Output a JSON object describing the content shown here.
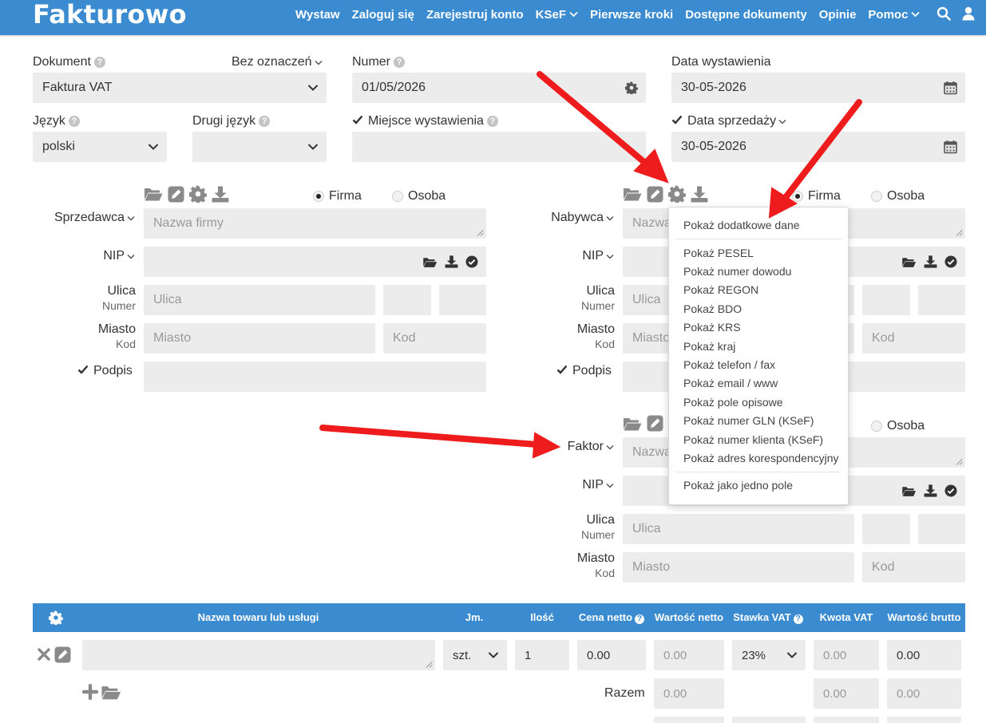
{
  "nav": {
    "logo": "Fakturowo",
    "items": [
      "Wystaw",
      "Zaloguj się",
      "Zarejestruj konto",
      "KSeF",
      "Pierwsze kroki",
      "Dostępne dokumenty",
      "Opinie",
      "Pomoc"
    ]
  },
  "form": {
    "dokument_label": "Dokument",
    "bez_oznaczen": "Bez oznaczeń",
    "dokument_value": "Faktura VAT",
    "numer_label": "Numer",
    "numer_value": "01/05/2026",
    "data_wystawienia_label": "Data wystawienia",
    "data_wystawienia_value": "30-05-2026",
    "jezyk_label": "Język",
    "jezyk_value": "polski",
    "drugi_jezyk_label": "Drugi język",
    "drugi_jezyk_value": "",
    "miejsce_label": "Miejsce wystawienia",
    "data_sprzedazy_label": "Data sprzedaży",
    "data_sprzedazy_value": "30-05-2026"
  },
  "seller": {
    "title": "Sprzedawca",
    "firma": "Firma",
    "osoba": "Osoba",
    "name_placeholder": "Nazwa firmy",
    "nip_label": "NIP",
    "ulica_label": "Ulica",
    "numer_label": "Numer",
    "ulica_placeholder": "Ulica",
    "miasto_label": "Miasto",
    "kod_label": "Kod",
    "miasto_placeholder": "Miasto",
    "kod_placeholder": "Kod",
    "podpis_label": "Podpis"
  },
  "buyer": {
    "title": "Nabywca",
    "firma": "Firma",
    "osoba": "Osoba",
    "name_placeholder": "Nazwa",
    "nip_label": "NIP",
    "ulica_label": "Ulica",
    "numer_label": "Numer",
    "ulica_placeholder": "Ulica",
    "miasto_label": "Miasto",
    "kod_label": "Kod",
    "miasto_placeholder": "Miasto",
    "kod_placeholder": "Kod",
    "podpis_label": "Podpis"
  },
  "faktor": {
    "title": "Faktor",
    "osoba": "Osoba",
    "name_placeholder": "Nazwa",
    "nip_label": "NIP",
    "ulica_label": "Ulica",
    "numer_label": "Numer",
    "ulica_placeholder": "Ulica",
    "miasto_label": "Miasto",
    "kod_label": "Kod",
    "miasto_placeholder": "Miasto",
    "kod_placeholder": "Kod"
  },
  "menu": {
    "items": [
      "Pokaż dodatkowe dane",
      "Pokaż PESEL",
      "Pokaż numer dowodu",
      "Pokaż REGON",
      "Pokaż BDO",
      "Pokaż KRS",
      "Pokaż kraj",
      "Pokaż telefon / fax",
      "Pokaż email / www",
      "Pokaż pole opisowe",
      "Pokaż numer GLN (KSeF)",
      "Pokaż numer klienta (KSeF)",
      "Pokaż adres korespondencyjny",
      "Pokaż jako jedno pole"
    ]
  },
  "table": {
    "headers": [
      "Nazwa towaru lub usługi",
      "Jm.",
      "Ilość",
      "Cena netto",
      "Wartość netto",
      "Stawka VAT",
      "Kwota VAT",
      "Wartość brutto"
    ],
    "row": {
      "jm": "szt.",
      "ilosc": "1",
      "cena_netto": "0.00",
      "wartosc_netto": "0.00",
      "stawka_vat": "23%",
      "kwota_vat": "0.00",
      "wartosc_brutto": "0.00"
    },
    "razem_label": "Razem",
    "razem": {
      "wartosc_netto": "0.00",
      "kwota_vat": "0.00",
      "wartosc_brutto": "0.00"
    }
  },
  "colors": {
    "primary": "#3a8bd0",
    "field_bg": "#ececec",
    "arrow": "#ee1c1c"
  }
}
